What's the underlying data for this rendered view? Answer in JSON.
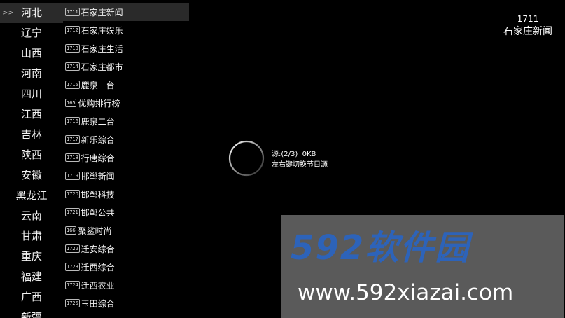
{
  "provinces": {
    "selected_marker": ">>",
    "items": [
      "河北",
      "辽宁",
      "山西",
      "河南",
      "四川",
      "江西",
      "吉林",
      "陕西",
      "安徽",
      "黑龙江",
      "云南",
      "甘肃",
      "重庆",
      "福建",
      "广西",
      "新疆"
    ]
  },
  "channels": [
    {
      "num": "1711",
      "name": "石家庄新闻"
    },
    {
      "num": "1712",
      "name": "石家庄娱乐"
    },
    {
      "num": "1713",
      "name": "石家庄生活"
    },
    {
      "num": "1714",
      "name": "石家庄都市"
    },
    {
      "num": "1715",
      "name": "鹿泉一台"
    },
    {
      "num": "165",
      "name": "优购排行榜"
    },
    {
      "num": "1716",
      "name": "鹿泉二台"
    },
    {
      "num": "1717",
      "name": "新乐综合"
    },
    {
      "num": "1718",
      "name": "行唐综合"
    },
    {
      "num": "1719",
      "name": "邯郸新闻"
    },
    {
      "num": "1720",
      "name": "邯郸科技"
    },
    {
      "num": "1721",
      "name": "邯郸公共"
    },
    {
      "num": "166",
      "name": "聚鲨时尚"
    },
    {
      "num": "1722",
      "name": "迁安综合"
    },
    {
      "num": "1723",
      "name": "迁西综合"
    },
    {
      "num": "1724",
      "name": "迁西农业"
    },
    {
      "num": "1725",
      "name": "玉田综合"
    }
  ],
  "now_playing": {
    "num": "1711",
    "name": "石家庄新闻"
  },
  "loading": {
    "source": "源:(2/3)",
    "speed": "0KB",
    "hint": "左右键切换节目源"
  },
  "watermark": {
    "brand": "592软件园",
    "url": "www.592xiazai.com"
  }
}
